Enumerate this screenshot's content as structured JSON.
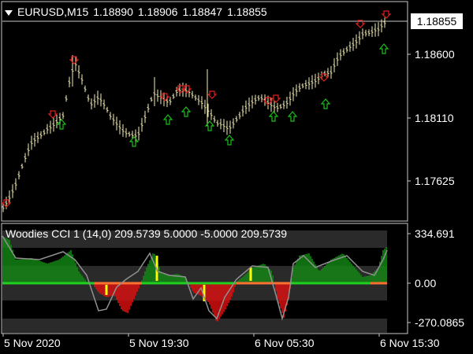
{
  "header": {
    "symbol": "EURUSD,M15",
    "open": "1.18890",
    "high": "1.18906",
    "low": "1.18847",
    "close": "1.18855"
  },
  "price_axis": {
    "current_price": "1.18855",
    "ticks": [
      "1.18600",
      "1.18110",
      "1.17625"
    ]
  },
  "indicator": {
    "title": "Woodies CCI 1 (14,0) 209.5739 5.0000 -5.0000 209.5739",
    "ticks": [
      "334.691",
      "0.00",
      "-270.0865"
    ]
  },
  "time_axis": {
    "labels": [
      "5 Nov 2020",
      "5 Nov 19:30",
      "6 Nov 05:30",
      "6 Nov 15:30"
    ]
  },
  "colors": {
    "background": "#000000",
    "candles": "#f5f0b0",
    "up_arrow": "#18c018",
    "down_arrow": "#e02020",
    "histogram_pos": "#138a13",
    "histogram_neg": "#e01010",
    "zero_line_green": "#20d020",
    "zero_line_orange": "#ff7030",
    "band": "#2a2a2a",
    "cci_line": "#909090",
    "highlight_bar": "#ffff00"
  },
  "chart_data": {
    "type": "line",
    "series": [],
    "ylim": [
      1.1725,
      1.1895
    ],
    "indicator_ylim": [
      -270.0865,
      334.691
    ]
  }
}
